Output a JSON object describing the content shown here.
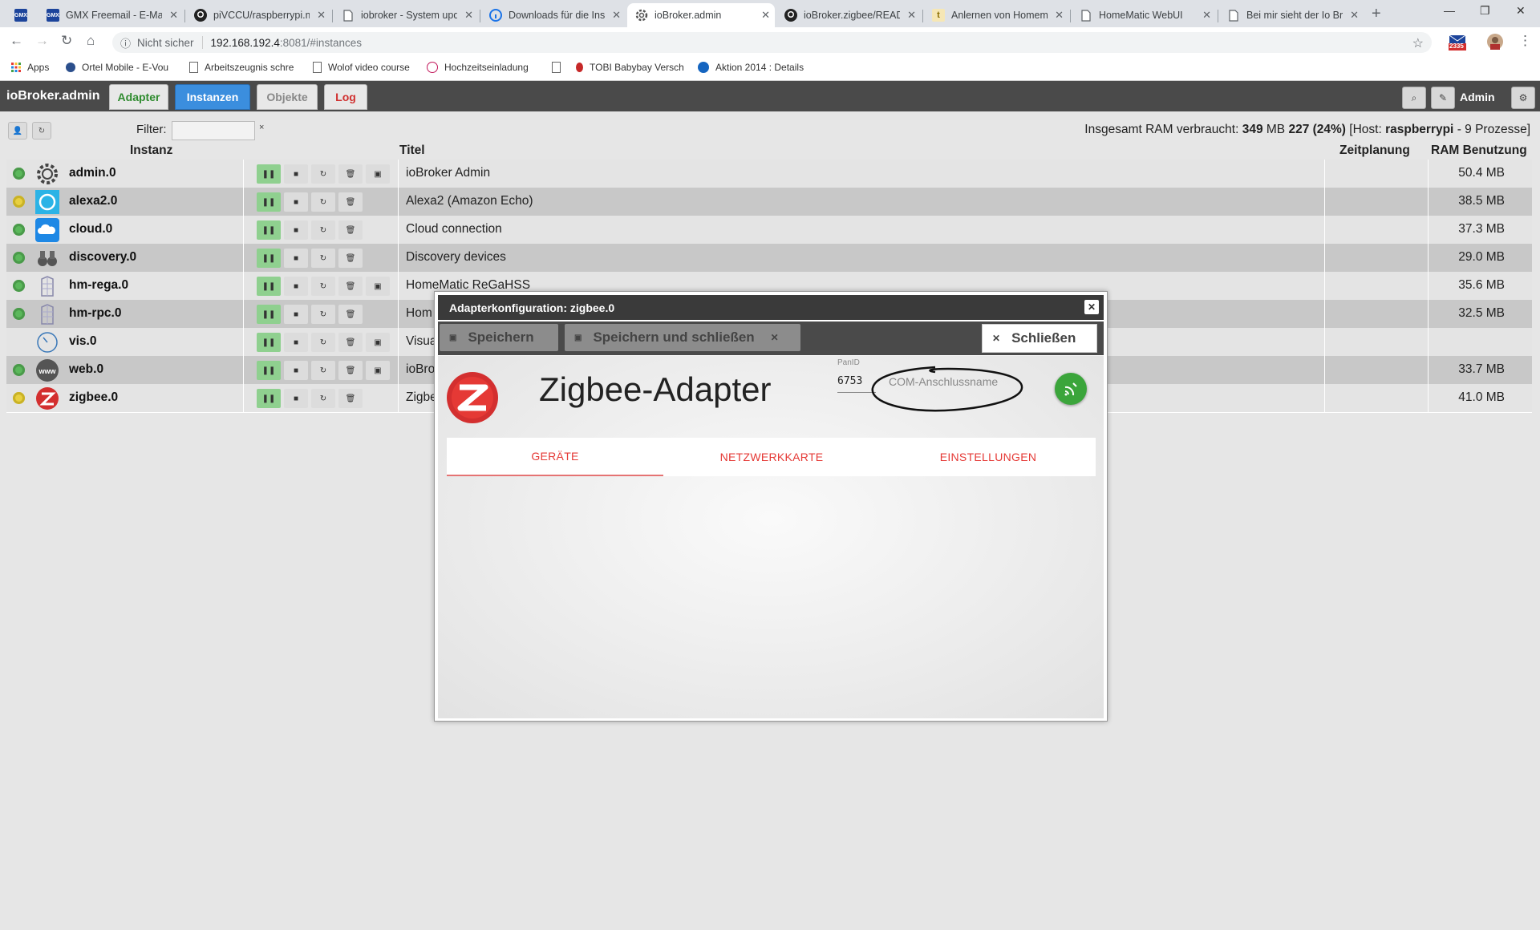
{
  "browser": {
    "tabs": [
      {
        "label": "",
        "icon": "gmx-favicon"
      },
      {
        "label": "GMX Freemail - E-Mail",
        "icon": "gmx-favicon"
      },
      {
        "label": "piVCCU/raspberrypi.m",
        "icon": "github-icon"
      },
      {
        "label": "iobroker - System upd",
        "icon": "page-icon"
      },
      {
        "label": "Downloads für die Inst",
        "icon": "info-icon"
      },
      {
        "label": "ioBroker.admin",
        "icon": "gear-icon"
      },
      {
        "label": "ioBroker.zigbee/READ",
        "icon": "github-icon"
      },
      {
        "label": "Anlernen von Homem",
        "icon": "t-icon"
      },
      {
        "label": "HomeMatic WebUI",
        "icon": "page-icon"
      },
      {
        "label": "Bei mir sieht der Io Br",
        "icon": "page-icon"
      }
    ],
    "address": {
      "security": "Nicht sicher",
      "host": "192.168.192.4",
      "path": ":8081/#instances"
    },
    "mail_badge": "2335",
    "bookmarks": [
      {
        "label": "Apps",
        "icon": "apps-grid-icon"
      },
      {
        "label": "Ortel Mobile - E-Vou",
        "icon": "globe-icon"
      },
      {
        "label": "Arbeitszeugnis schre",
        "icon": "page-icon"
      },
      {
        "label": "Wolof video course",
        "icon": "page-icon"
      },
      {
        "label": "Hochzeitseinladung",
        "icon": "flower-icon"
      },
      {
        "label": "",
        "icon": "page-icon"
      },
      {
        "label": "TOBI Babybay Versch",
        "icon": "tobi-icon"
      },
      {
        "label": "Aktion 2014 : Details",
        "icon": "play-icon"
      }
    ]
  },
  "header": {
    "title": "ioBroker.admin",
    "tabs": [
      {
        "label": "Adapter",
        "color": "#2e8b2e"
      },
      {
        "label": "Instanzen",
        "color": "#ffffff"
      },
      {
        "label": "Objekte",
        "color": "#888888"
      },
      {
        "label": "Log",
        "color": "#d0302f"
      }
    ],
    "user": "Admin"
  },
  "toolbar": {
    "filter_label": "Filter:",
    "filter_value": "",
    "clear": "×",
    "ram_prefix": "Insgesamt RAM verbraucht:",
    "ram_mb": "349",
    "ram_unit": "MB",
    "ram_free": "227 (24%)",
    "host_prefix": "[Host:",
    "host": "raspberrypi",
    "host_suffix": "- 9 Prozesse]"
  },
  "table": {
    "columns": [
      "Instanz",
      "Titel",
      "Zeitplanung",
      "RAM Benutzung"
    ],
    "rows": [
      {
        "name": "admin.0",
        "title": "ioBroker Admin",
        "ram": "50.4 MB",
        "status": "green",
        "icon": "gear-icon"
      },
      {
        "name": "alexa2.0",
        "title": "Alexa2 (Amazon Echo)",
        "ram": "38.5 MB",
        "status": "yellow",
        "icon": "alexa-icon"
      },
      {
        "name": "cloud.0",
        "title": "Cloud connection",
        "ram": "37.3 MB",
        "status": "green",
        "icon": "cloud-icon"
      },
      {
        "name": "discovery.0",
        "title": "Discovery devices",
        "ram": "29.0 MB",
        "status": "green",
        "icon": "binoculars-icon"
      },
      {
        "name": "hm-rega.0",
        "title": "HomeMatic ReGaHSS",
        "ram": "35.6 MB",
        "status": "green",
        "icon": "homematic-icon"
      },
      {
        "name": "hm-rpc.0",
        "title": "Hom",
        "ram": "32.5 MB",
        "status": "green",
        "icon": "homematic-icon"
      },
      {
        "name": "vis.0",
        "title": "Visua",
        "ram": "",
        "status": "none",
        "icon": "gauge-icon"
      },
      {
        "name": "web.0",
        "title": "ioBro",
        "ram": "33.7 MB",
        "status": "green",
        "icon": "www-icon"
      },
      {
        "name": "zigbee.0",
        "title": "Zigbe",
        "ram": "41.0 MB",
        "status": "yellow",
        "icon": "zigbee-icon"
      }
    ]
  },
  "modal": {
    "title": "Adapterkonfiguration: zigbee.0",
    "save": "Speichern",
    "save_close": "Speichern und schließen",
    "close": "Schließen",
    "heading": "Zigbee-Adapter",
    "panid_label": "PanID",
    "panid_value": "6753",
    "com_placeholder": "COM-Anschlussname",
    "tabs": [
      "GERÄTE",
      "NETZWERKKARTE",
      "EINSTELLUNGEN"
    ]
  }
}
